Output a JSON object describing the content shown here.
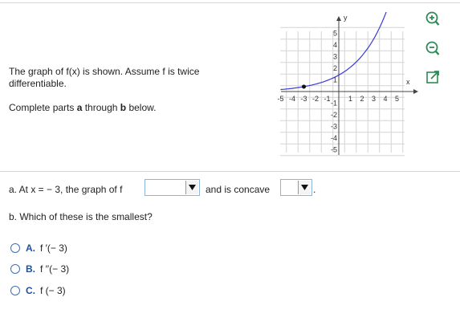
{
  "question": {
    "intro_line1": "The graph of f(x) is shown. Assume f is twice",
    "intro_line2": "differentiable.",
    "complete_prefix": "Complete parts ",
    "complete_a": "a",
    "complete_mid": " through ",
    "complete_b": "b",
    "complete_suffix": " below."
  },
  "graph": {
    "x_label": "x",
    "y_label": "y",
    "x_ticks": [
      "-5",
      "-4",
      "-3",
      "-2",
      "-1",
      "1",
      "2",
      "3",
      "4",
      "5"
    ],
    "y_ticks_pos": [
      "5",
      "4",
      "3",
      "2",
      "1"
    ],
    "y_ticks_neg": [
      "-1",
      "-2",
      "-3",
      "-4",
      "-5"
    ],
    "curve_color": "#3a3ad6",
    "point_x": -3
  },
  "part_a": {
    "prefix": "a. At x = − 3, the graph of f",
    "middle": "and is concave",
    "suffix": ".",
    "dropdown1_value": "",
    "dropdown2_value": ""
  },
  "part_b": {
    "prompt": "b. Which of these is the smallest?",
    "options": [
      {
        "letter": "A.",
        "text": "f ′(− 3)"
      },
      {
        "letter": "B.",
        "text": "f ′′(− 3)"
      },
      {
        "letter": "C.",
        "text": "f (− 3)"
      }
    ]
  },
  "tools": {
    "zoom_in": "zoom-in-icon",
    "zoom_out": "zoom-out-icon",
    "popout": "popout-icon",
    "accent": "#2e8b57"
  }
}
